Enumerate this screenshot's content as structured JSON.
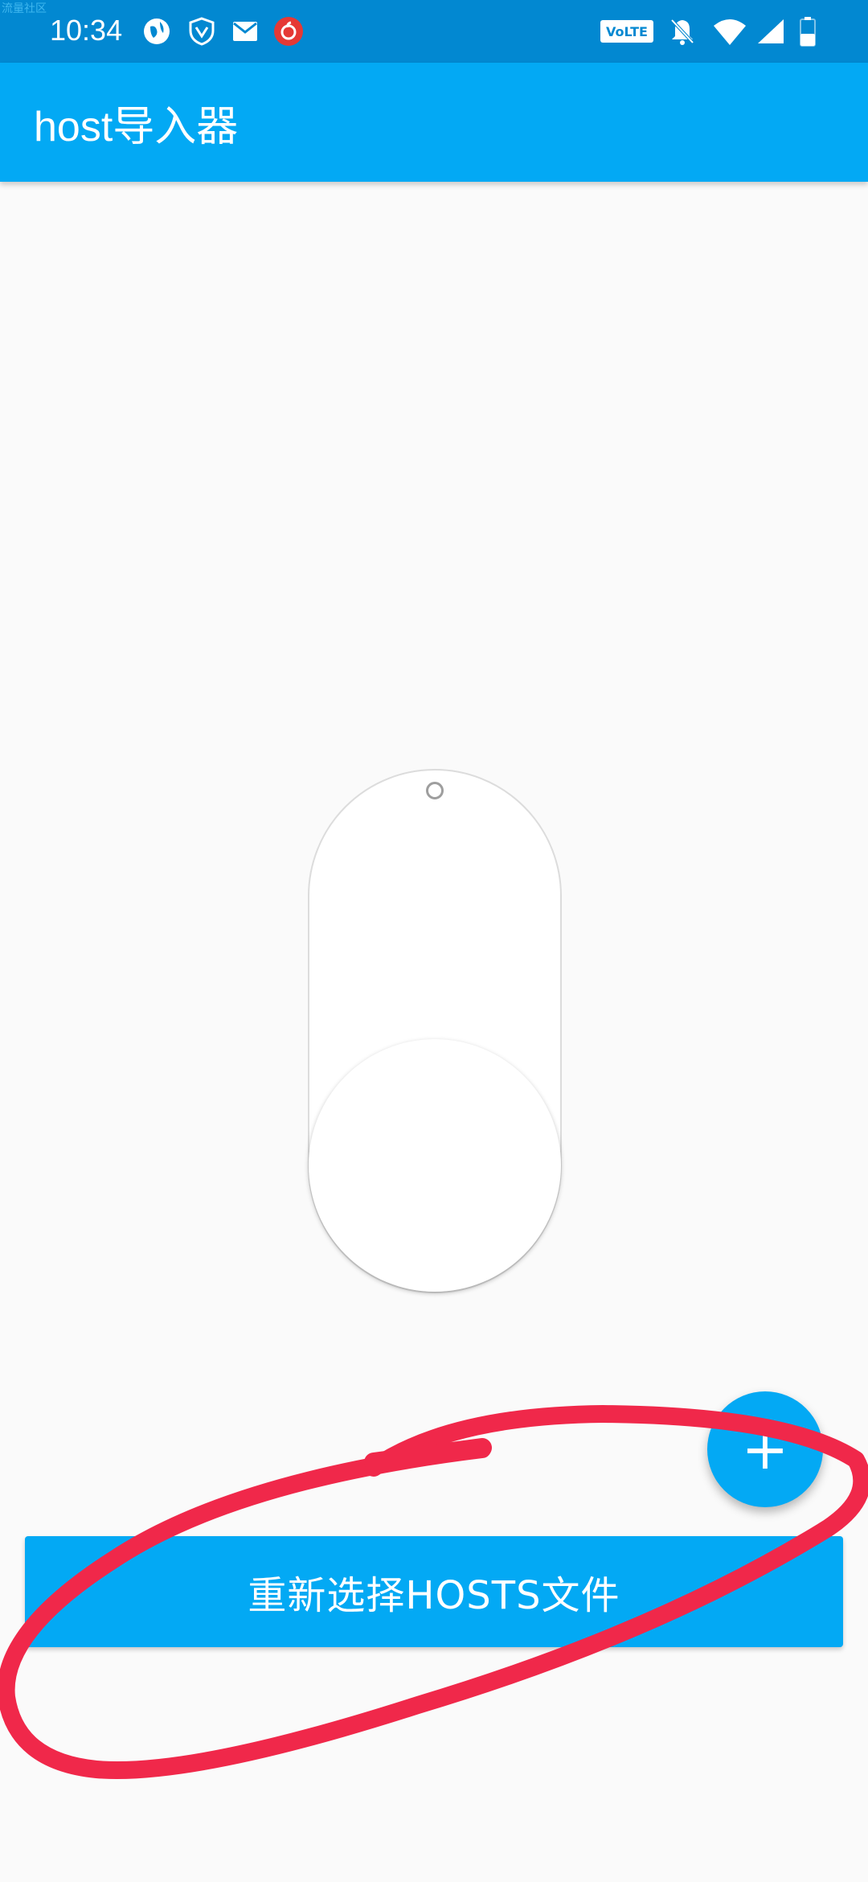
{
  "watermark": "流量社区",
  "status_bar": {
    "time": "10:34",
    "left_icons": [
      "browser-icon",
      "vpn-shield-icon",
      "mail-icon",
      "netease-music-icon"
    ],
    "volte_label": "VoLTE",
    "right_icons": [
      "volte-icon",
      "notifications-off-icon",
      "wifi-icon",
      "cell-signal-icon",
      "battery-icon"
    ]
  },
  "app_bar": {
    "title": "host导入器"
  },
  "toggle": {
    "state": "off"
  },
  "fab": {
    "label": "+"
  },
  "bottom_button": {
    "label": "重新选择HOSTS文件"
  },
  "colors": {
    "status_bar": "#0288d1",
    "app_bar": "#03a9f4",
    "background": "#fafafa",
    "accent": "#03a9f4",
    "annotation_stroke": "#f0284a"
  }
}
